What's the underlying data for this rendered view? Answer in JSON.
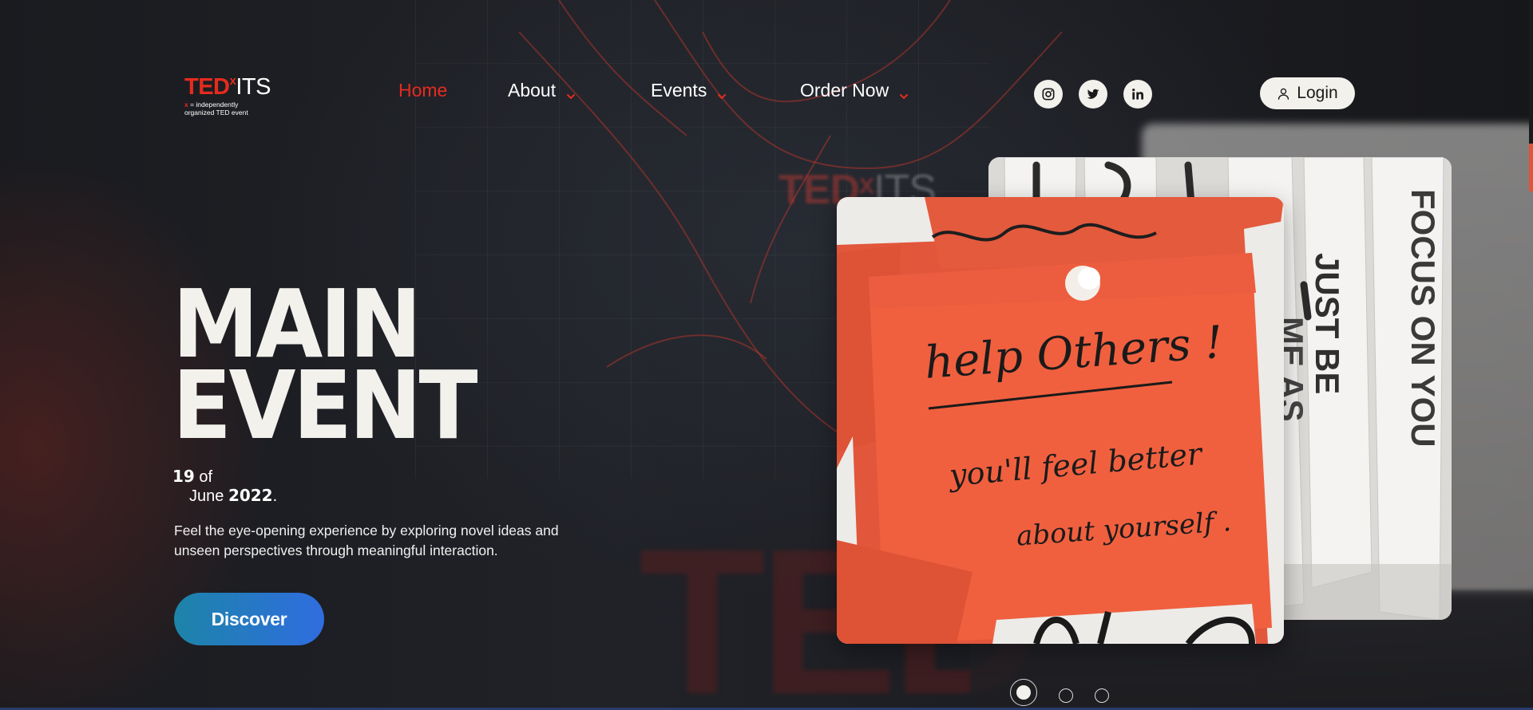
{
  "header": {
    "logo": {
      "brand": "TED",
      "x": "x",
      "suffix": "ITS",
      "tagline_x": "x",
      "tagline_1": " = independently",
      "tagline_2": "organized TED event"
    },
    "nav": [
      {
        "label": "Home",
        "active": true,
        "dropdown": false
      },
      {
        "label": "About",
        "active": false,
        "dropdown": true
      },
      {
        "label": "Events",
        "active": false,
        "dropdown": true
      },
      {
        "label": "Order Now",
        "active": false,
        "dropdown": true
      }
    ],
    "socials": [
      "instagram-icon",
      "twitter-icon",
      "linkedin-icon"
    ],
    "login_label": "Login"
  },
  "hero": {
    "title_line1": "MAIN",
    "title_line2": "EVENT",
    "date_day": "19",
    "date_of": " of",
    "date_month": "June ",
    "date_year": "2022",
    "date_end": ".",
    "description": "Feel the eye-opening experience by exploring novel ideas and unseen perspectives through meaningful interaction.",
    "cta_label": "Discover"
  },
  "slider": {
    "front_note_line1": "help Others !",
    "front_note_line2": "you'll feel better",
    "front_note_line3": "about yourself .",
    "back_banner_1": "JUST BE",
    "back_banner_2": "FOCUS ON YOU",
    "back_banner_3": "ME AS",
    "dots": 3,
    "active_dot": 0
  },
  "background": {
    "ghost_logo": "TED",
    "ghost_logo_suffix": "ITS"
  },
  "colors": {
    "accent": "#e62b1e",
    "cta_start": "#1d84a8",
    "cta_end": "#2f6de0",
    "cream": "#f3f1ec"
  }
}
